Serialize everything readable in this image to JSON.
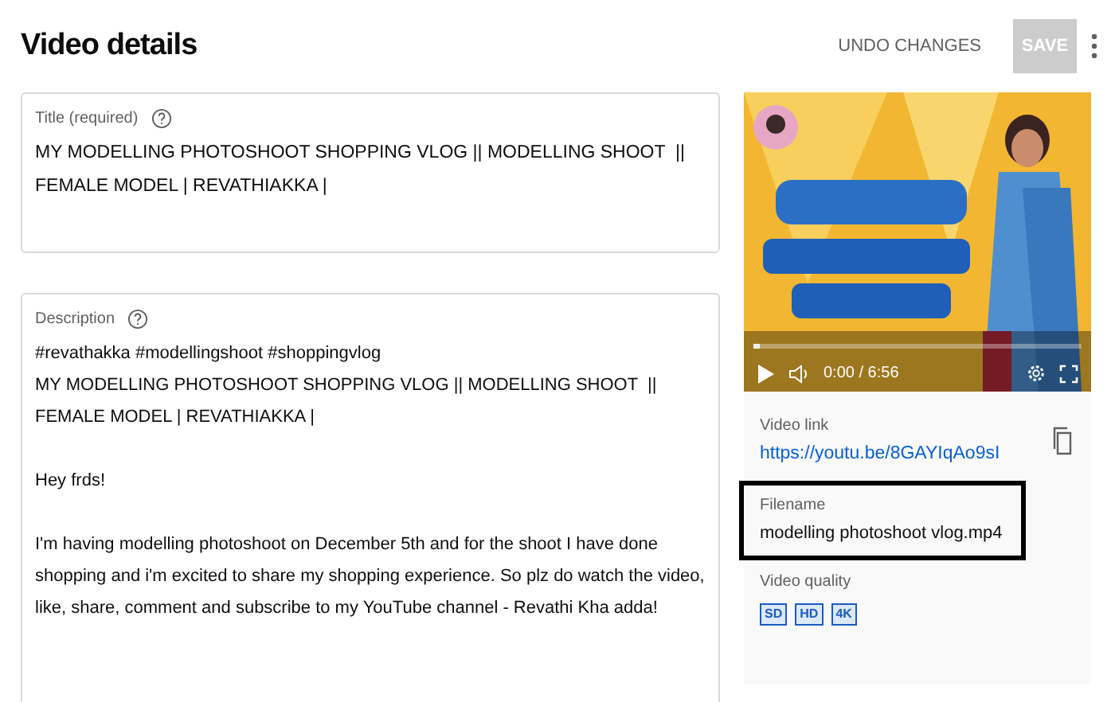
{
  "header": {
    "title": "Video details",
    "undo_label": "UNDO CHANGES",
    "save_label": "SAVE",
    "save_disabled": true
  },
  "title_field": {
    "label": "Title (required)",
    "value": "MY MODELLING PHOTOSHOOT SHOPPING VLOG || MODELLING SHOOT  || FEMALE MODEL | REVATHIAKKA |"
  },
  "description_field": {
    "label": "Description",
    "value": "#revathakka #modellingshoot #shoppingvlog\nMY MODELLING PHOTOSHOOT SHOPPING VLOG || MODELLING SHOOT  || FEMALE MODEL | REVATHIAKKA |\n\nHey frds!\n\nI'm having modelling photoshoot on December 5th and for the shoot I have done shopping and i'm excited to share my shopping experience. So plz do watch the video, like, share, comment and subscribe to my YouTube channel - Revathi Kha adda!"
  },
  "player": {
    "time": "0:00 / 6:56",
    "level": 0.0
  },
  "video_link": {
    "label": "Video link",
    "url": "https://youtu.be/8GAYIqAo9sI"
  },
  "filename": {
    "label": "Filename",
    "value": "modelling photoshoot vlog.mp4",
    "highlighted": true
  },
  "video_quality": {
    "label": "Video quality",
    "badges": [
      "SD",
      "HD",
      "4K"
    ]
  }
}
